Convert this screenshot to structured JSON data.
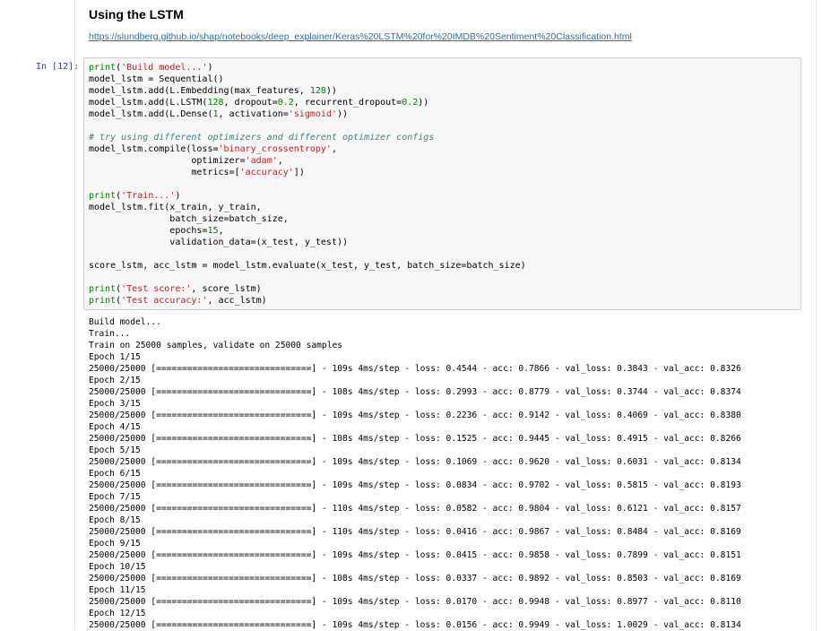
{
  "markdown": {
    "title": "Using the LSTM",
    "link": "https://slundberg.github.io/shap/notebooks/deep_explainer/Keras%20LSTM%20for%20IMDB%20Sentiment%20Classification.html"
  },
  "cell": {
    "prompt": "In [12]:",
    "code_lines": [
      "print('Build model...')",
      "model_lstm = Sequential()",
      "model_lstm.add(L.Embedding(max_features, 128))",
      "model_lstm.add(L.LSTM(128, dropout=0.2, recurrent_dropout=0.2))",
      "model_lstm.add(L.Dense(1, activation='sigmoid'))",
      "",
      "# try using different optimizers and different optimizer configs",
      "model_lstm.compile(loss='binary_crossentropy',",
      "                   optimizer='adam',",
      "                   metrics=['accuracy'])",
      "",
      "print('Train...')",
      "model_lstm.fit(x_train, y_train,",
      "               batch_size=batch_size,",
      "               epochs=15,",
      "               validation_data=(x_test, y_test))",
      "",
      "score_lstm, acc_lstm = model_lstm.evaluate(x_test, y_test, batch_size=batch_size)",
      "",
      "print('Test score:', score_lstm)",
      "print('Test accuracy:', acc_lstm)"
    ],
    "output_lines": [
      "Build model...",
      "Train...",
      "Train on 25000 samples, validate on 25000 samples",
      "Epoch 1/15",
      "25000/25000 [==============================] - 109s 4ms/step - loss: 0.4544 - acc: 0.7866 - val_loss: 0.3843 - val_acc: 0.8326",
      "Epoch 2/15",
      "25000/25000 [==============================] - 108s 4ms/step - loss: 0.2993 - acc: 0.8779 - val_loss: 0.3744 - val_acc: 0.8374",
      "Epoch 3/15",
      "25000/25000 [==============================] - 109s 4ms/step - loss: 0.2236 - acc: 0.9142 - val_loss: 0.4069 - val_acc: 0.8380",
      "Epoch 4/15",
      "25000/25000 [==============================] - 108s 4ms/step - loss: 0.1525 - acc: 0.9445 - val_loss: 0.4915 - val_acc: 0.8266",
      "Epoch 5/15",
      "25000/25000 [==============================] - 109s 4ms/step - loss: 0.1069 - acc: 0.9620 - val_loss: 0.6031 - val_acc: 0.8134",
      "Epoch 6/15",
      "25000/25000 [==============================] - 109s 4ms/step - loss: 0.0834 - acc: 0.9702 - val_loss: 0.5815 - val_acc: 0.8193",
      "Epoch 7/15",
      "25000/25000 [==============================] - 110s 4ms/step - loss: 0.0582 - acc: 0.9804 - val_loss: 0.6121 - val_acc: 0.8157",
      "Epoch 8/15",
      "25000/25000 [==============================] - 110s 4ms/step - loss: 0.0416 - acc: 0.9867 - val_loss: 0.8484 - val_acc: 0.8169",
      "Epoch 9/15",
      "25000/25000 [==============================] - 109s 4ms/step - loss: 0.0415 - acc: 0.9858 - val_loss: 0.7899 - val_acc: 0.8151",
      "Epoch 10/15",
      "25000/25000 [==============================] - 108s 4ms/step - loss: 0.0337 - acc: 0.9892 - val_loss: 0.8503 - val_acc: 0.8169",
      "Epoch 11/15",
      "25000/25000 [==============================] - 109s 4ms/step - loss: 0.0170 - acc: 0.9948 - val_loss: 0.8977 - val_acc: 0.8110",
      "Epoch 12/15",
      "25000/25000 [==============================] - 109s 4ms/step - loss: 0.0156 - acc: 0.9949 - val_loss: 1.0029 - val_acc: 0.8134"
    ]
  },
  "colors": {
    "prompt": "#303f9f",
    "link": "#296eaa",
    "string": "#ba2121",
    "number": "#008000",
    "comment": "#408080",
    "input_background": "#f7f7f7"
  }
}
